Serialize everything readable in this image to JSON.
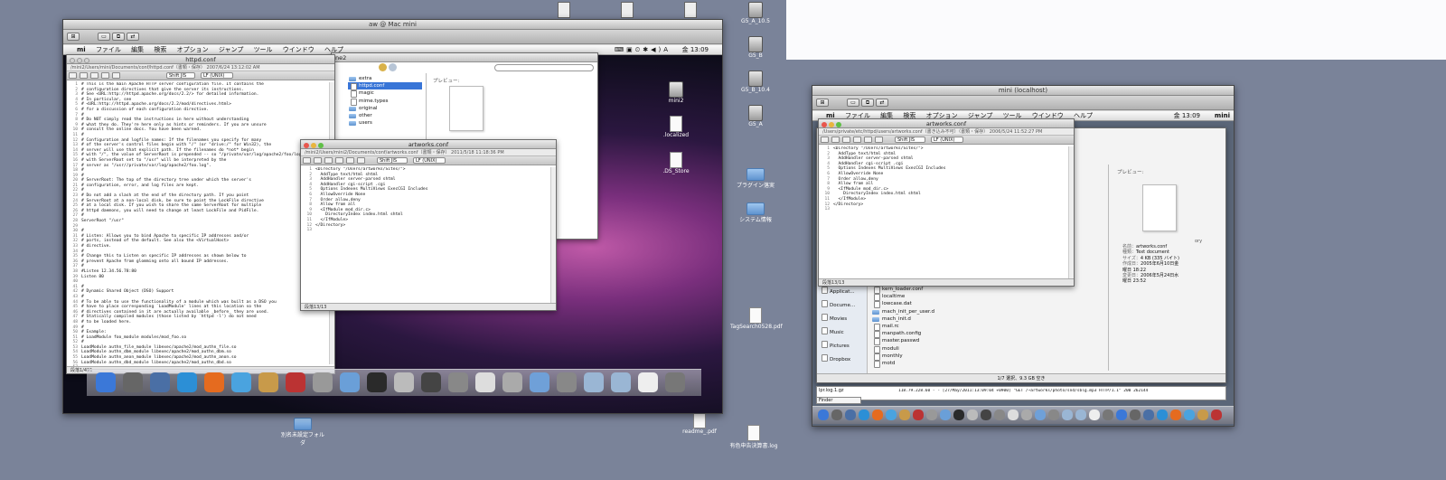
{
  "left_desktop": {
    "icons": [
      {
        "label": "",
        "type": "doc"
      },
      {
        "label": "",
        "type": "doc"
      },
      {
        "label": "",
        "type": "doc"
      },
      {
        "label": "G5_A_10.5",
        "type": "drive"
      },
      {
        "label": "G5_B",
        "type": "drive"
      },
      {
        "label": "G5_B_10.4",
        "type": "drive"
      },
      {
        "label": "G5_A",
        "type": "drive"
      },
      {
        "label": "プラグイン落実",
        "type": "folder"
      },
      {
        "label": "システム情報",
        "type": "folder"
      },
      {
        "label": "TagSearch0528.pdf",
        "type": "doc"
      },
      {
        "label": "readme_.pdf",
        "type": "doc"
      },
      {
        "label": "有色申告決算書.log",
        "type": "doc"
      },
      {
        "label": "別名未設定フォルダ",
        "type": "folder"
      }
    ]
  },
  "vnc_left": {
    "window_title": "aw @ Mac mini",
    "menu": [
      "mi",
      "ファイル",
      "編集",
      "検索",
      "オプション",
      "ジャンプ",
      "ツール",
      "ウインドウ",
      "ヘルプ"
    ],
    "clock": "金 13:09",
    "desktop_icons": [
      {
        "label": "mini2",
        "type": "drive"
      },
      {
        "label": ".localized",
        "type": "doc"
      },
      {
        "label": ".DS_Store",
        "type": "doc"
      }
    ],
    "httpd_window": {
      "title": "httpd.conf",
      "path": "/mini2/Users/mini/Documents/conf/httpd.conf（書類・保存）  2007/6/24 13:12:02 AM",
      "status": "段落1/491",
      "lines": [
        "# This is the main Apache HTTP server configuration file. It contains the",
        "# configuration directives that give the server its instructions.",
        "# See <URL:http://httpd.apache.org/docs/2.2/> for detailed information.",
        "# In particular, see",
        "# <URL:http://httpd.apache.org/docs/2.2/mod/directives.html>",
        "# for a discussion of each configuration directive.",
        "#",
        "# Do NOT simply read the instructions in here without understanding",
        "# what they do. They're here only as hints or reminders. If you are unsure",
        "# consult the online docs. You have been warned.",
        "#",
        "# Configuration and logfile names: If the filenames you specify for many",
        "# of the server's control files begin with \"/\" (or \"drive:/\" for Win32), the",
        "# server will use that explicit path. If the filenames do *not* begin",
        "# with \"/\", the value of ServerRoot is prepended -- so \"/private/var/log/apache2/foo/log\"",
        "# with ServerRoot set to \"/usr\" will be interpreted by the",
        "# server as \"/usr//private/var/log/apache2/foo.log\".",
        "#",
        "#",
        "# ServerRoot: The top of the directory tree under which the server's",
        "# configuration, error, and log files are kept.",
        "#",
        "# Do not add a slash at the end of the directory path. If you point",
        "# ServerRoot at a non-local disk, be sure to point the LockFile directive",
        "# at a local disk. If you wish to share the same ServerRoot for multiple",
        "# httpd daemons, you will need to change at least LockFile and PidFile.",
        "#",
        "ServerRoot \"/usr\"",
        "",
        "#",
        "# Listen: Allows you to bind Apache to specific IP addresses and/or",
        "# ports, instead of the default. See also the <VirtualHost>",
        "# directive.",
        "#",
        "# Change this to Listen on specific IP addresses as shown below to",
        "# prevent Apache from glomming onto all bound IP addresses.",
        "#",
        "#Listen 12.34.56.78:80",
        "Listen 80",
        "",
        "#",
        "# Dynamic Shared Object (DSO) Support",
        "#",
        "# To be able to use the functionality of a module which was built as a DSO you",
        "# have to place corresponding `LoadModule' lines at this location so the",
        "# directives contained in it are actually available _before_ they are used.",
        "# Statically compiled modules (those listed by `httpd -l') do not need",
        "# to be loaded here.",
        "#",
        "# Example:",
        "# LoadModule foo_module modules/mod_foo.so",
        "#",
        "LoadModule authn_file_module libexec/apache2/mod_authn_file.so",
        "LoadModule authn_dbm_module libexec/apache2/mod_authn_dbm.so",
        "LoadModule authn_anon_module libexec/apache2/mod_authn_anon.so",
        "LoadModule authn_dbd_module libexec/apache2/mod_authn_dbd.so",
        "LoadModule authn_default_module libexec/apache2/mod_authn_default.so"
      ]
    },
    "finder_window": {
      "title": "ne2",
      "items": [
        "extra",
        "httpd.conf",
        "magic",
        "mime.types",
        "original",
        "other",
        "users"
      ],
      "selected": "httpd.conf",
      "preview_label": "プレビュー:"
    },
    "artworks_window": {
      "title": "artworks.conf",
      "path": "/mini2/Users/mini2/Documents/conf/artworks.conf（書類・保存）  2011/5/18 11:18:36 PM",
      "encoding": "Shift JIS",
      "lineend": "LF (UNIX)",
      "status": "段落13/13",
      "lines": [
        "<Directory \"/Users/artworks/Sites/\">",
        "  AddType text/html shtml",
        "  AddHandler server-parsed shtml",
        "  AddHandler cgi-script .cgi",
        "  Options Indexes MultiViews ExecCGI Includes",
        "  AllowOverride None",
        "  Order allow,deny",
        "  Allow from all",
        "  <IfModule mod_dir.c>",
        "    DirectoryIndex index.html shtml",
        "  </IfModule>",
        "</Directory>",
        ""
      ]
    }
  },
  "vnc_right": {
    "window_title": "mini (localhost)",
    "menu": [
      "mi",
      "ファイル",
      "編集",
      "検索",
      "オプション",
      "ジャンプ",
      "ツール",
      "ウインドウ",
      "ヘルプ"
    ],
    "clock": "金 13:09",
    "user": "mini",
    "artworks_window": {
      "title": "artworks.conf",
      "path": "/Users/private/etc/httpd/users/artworks.conf（書き込み不可）（書類・保存）  2006/5/24 11:52:27 PM",
      "encoding": "Shift JIS",
      "lineend": "LF (UNIX)",
      "status": "段落13/13",
      "lines": [
        "<Directory \"/Users/artworks/Sites/\">",
        "  AddType text/html shtml",
        "  AddHandler server-parsed shtml",
        "  AddHandler cgi-script .cgi",
        "  Options Indexes MultiViews ExecCGI Includes",
        "  AllowOverride None",
        "  Order allow,deny",
        "  Allow from all",
        "  <IfModule mod_dir.c>",
        "    DirectoryIndex index.html shtml",
        "  </IfModule>",
        "</Directory>",
        ""
      ]
    },
    "finder": {
      "sidebar": [
        "Applicat...",
        "Docume...",
        "Movies",
        "Music",
        "Pictures",
        "Dropbox"
      ],
      "files": [
        "kern_loader.conf",
        "localtime",
        "lowcase.dat",
        "mach_init_per_user.d",
        "mach_init.d",
        "mail.rc",
        "manpath.config",
        "master.passwd",
        "moduli",
        "monthly",
        "motd"
      ],
      "status": "1/7 選択、9.3 GB 空き",
      "preview_label": "プレビュー:",
      "info": [
        {
          "k": "名前：",
          "v": "artworks.conf"
        },
        {
          "k": "種類：",
          "v": "Text document"
        },
        {
          "k": "サイズ：",
          "v": "4 KB (335 バイト)"
        },
        {
          "k": "作成日：",
          "v": "2005年6月10日金曜日 18:22"
        },
        {
          "k": "変更日：",
          "v": "2006年5月24日水曜日 23:52"
        }
      ],
      "side_text": "ory"
    },
    "terminal_lines": [
      "118.79.228.60 - - [27/May/2011:13:09:04 +0900] \"GET /~artworks/photo/snd/sblg.mp3 HTTP/1.1\" 200 262144"
    ],
    "bottom_field": "Finder",
    "file_label": "lpr.log.1.gz"
  }
}
